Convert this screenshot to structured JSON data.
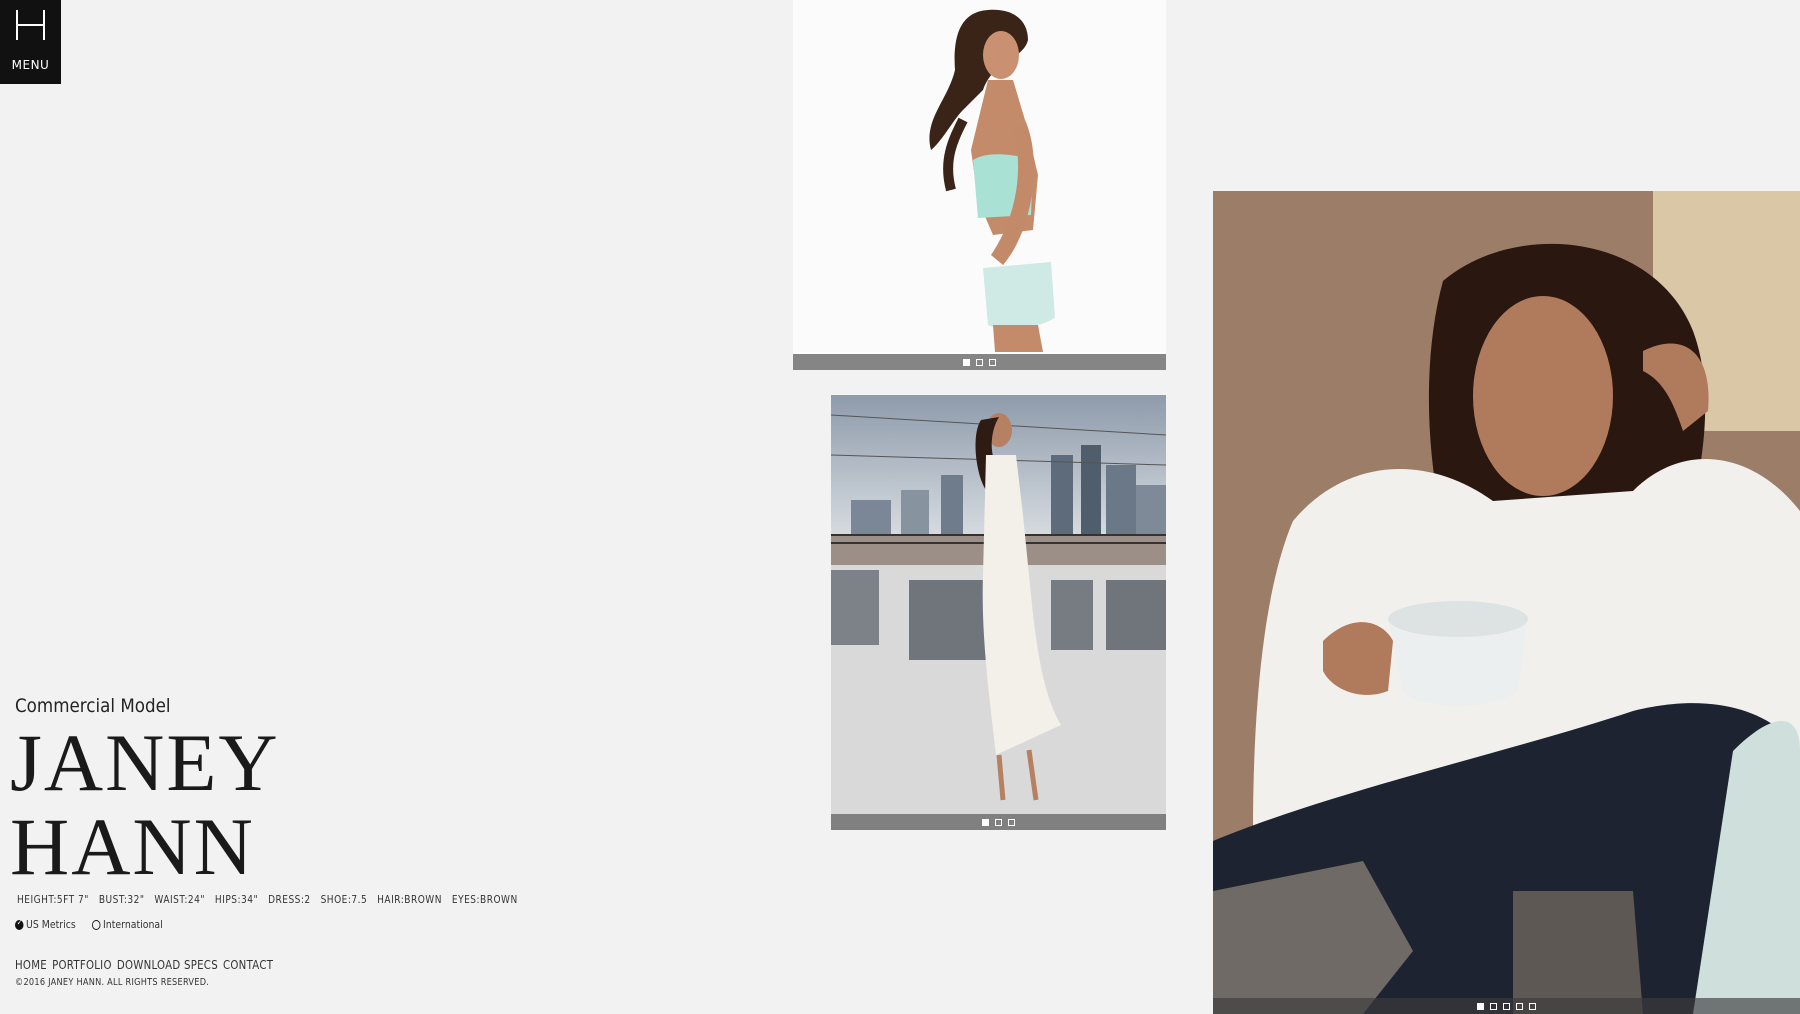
{
  "menu": {
    "label": "MENU",
    "logo_icon": "h-monogram-icon"
  },
  "profile": {
    "subtitle": "Commercial Model",
    "name_line1": "JANEY",
    "name_line2": "HANN",
    "stats": [
      "HEIGHT:5FT 7\"",
      "BUST:32\"",
      "WAIST:24\"",
      "HIPS:34\"",
      "DRESS:2",
      "SHOE:7.5",
      "HAIR:BROWN",
      "EYES:BROWN"
    ],
    "units": {
      "us": "US Metrics",
      "international": "International",
      "selected": "us"
    }
  },
  "nav": {
    "home": "HOME",
    "portfolio": "PORTFOLIO",
    "download": "DOWNLOAD SPECS",
    "contact": "CONTACT"
  },
  "copyright": "©2016 JANEY HANN. ALL RIGHTS RESERVED.",
  "sliders": {
    "studio": {
      "dots": 3,
      "active": 1
    },
    "rooftop": {
      "dots": 3,
      "active": 1
    },
    "portrait": {
      "dots": 5,
      "active": 1
    }
  },
  "colors": {
    "background": "#f2f2f2",
    "menu_tile": "#111111",
    "pager_bar": "#7a7a7a"
  }
}
